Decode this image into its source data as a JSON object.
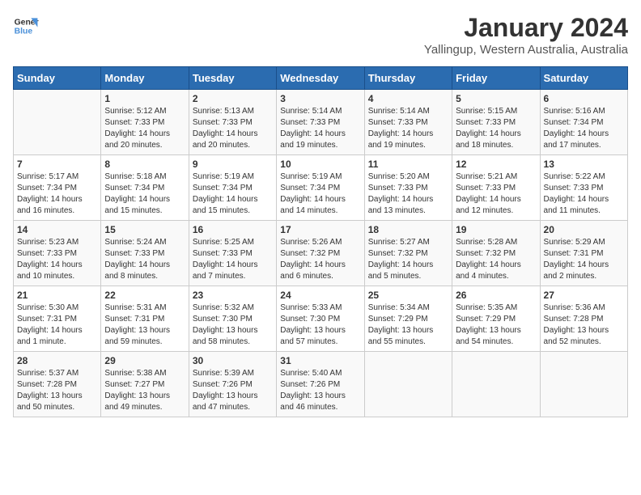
{
  "logo": {
    "line1": "General",
    "line2": "Blue"
  },
  "title": "January 2024",
  "subtitle": "Yallingup, Western Australia, Australia",
  "weekdays": [
    "Sunday",
    "Monday",
    "Tuesday",
    "Wednesday",
    "Thursday",
    "Friday",
    "Saturday"
  ],
  "weeks": [
    [
      {
        "num": "",
        "info": ""
      },
      {
        "num": "1",
        "info": "Sunrise: 5:12 AM\nSunset: 7:33 PM\nDaylight: 14 hours\nand 20 minutes."
      },
      {
        "num": "2",
        "info": "Sunrise: 5:13 AM\nSunset: 7:33 PM\nDaylight: 14 hours\nand 20 minutes."
      },
      {
        "num": "3",
        "info": "Sunrise: 5:14 AM\nSunset: 7:33 PM\nDaylight: 14 hours\nand 19 minutes."
      },
      {
        "num": "4",
        "info": "Sunrise: 5:14 AM\nSunset: 7:33 PM\nDaylight: 14 hours\nand 19 minutes."
      },
      {
        "num": "5",
        "info": "Sunrise: 5:15 AM\nSunset: 7:33 PM\nDaylight: 14 hours\nand 18 minutes."
      },
      {
        "num": "6",
        "info": "Sunrise: 5:16 AM\nSunset: 7:34 PM\nDaylight: 14 hours\nand 17 minutes."
      }
    ],
    [
      {
        "num": "7",
        "info": "Sunrise: 5:17 AM\nSunset: 7:34 PM\nDaylight: 14 hours\nand 16 minutes."
      },
      {
        "num": "8",
        "info": "Sunrise: 5:18 AM\nSunset: 7:34 PM\nDaylight: 14 hours\nand 15 minutes."
      },
      {
        "num": "9",
        "info": "Sunrise: 5:19 AM\nSunset: 7:34 PM\nDaylight: 14 hours\nand 15 minutes."
      },
      {
        "num": "10",
        "info": "Sunrise: 5:19 AM\nSunset: 7:34 PM\nDaylight: 14 hours\nand 14 minutes."
      },
      {
        "num": "11",
        "info": "Sunrise: 5:20 AM\nSunset: 7:33 PM\nDaylight: 14 hours\nand 13 minutes."
      },
      {
        "num": "12",
        "info": "Sunrise: 5:21 AM\nSunset: 7:33 PM\nDaylight: 14 hours\nand 12 minutes."
      },
      {
        "num": "13",
        "info": "Sunrise: 5:22 AM\nSunset: 7:33 PM\nDaylight: 14 hours\nand 11 minutes."
      }
    ],
    [
      {
        "num": "14",
        "info": "Sunrise: 5:23 AM\nSunset: 7:33 PM\nDaylight: 14 hours\nand 10 minutes."
      },
      {
        "num": "15",
        "info": "Sunrise: 5:24 AM\nSunset: 7:33 PM\nDaylight: 14 hours\nand 8 minutes."
      },
      {
        "num": "16",
        "info": "Sunrise: 5:25 AM\nSunset: 7:33 PM\nDaylight: 14 hours\nand 7 minutes."
      },
      {
        "num": "17",
        "info": "Sunrise: 5:26 AM\nSunset: 7:32 PM\nDaylight: 14 hours\nand 6 minutes."
      },
      {
        "num": "18",
        "info": "Sunrise: 5:27 AM\nSunset: 7:32 PM\nDaylight: 14 hours\nand 5 minutes."
      },
      {
        "num": "19",
        "info": "Sunrise: 5:28 AM\nSunset: 7:32 PM\nDaylight: 14 hours\nand 4 minutes."
      },
      {
        "num": "20",
        "info": "Sunrise: 5:29 AM\nSunset: 7:31 PM\nDaylight: 14 hours\nand 2 minutes."
      }
    ],
    [
      {
        "num": "21",
        "info": "Sunrise: 5:30 AM\nSunset: 7:31 PM\nDaylight: 14 hours\nand 1 minute."
      },
      {
        "num": "22",
        "info": "Sunrise: 5:31 AM\nSunset: 7:31 PM\nDaylight: 13 hours\nand 59 minutes."
      },
      {
        "num": "23",
        "info": "Sunrise: 5:32 AM\nSunset: 7:30 PM\nDaylight: 13 hours\nand 58 minutes."
      },
      {
        "num": "24",
        "info": "Sunrise: 5:33 AM\nSunset: 7:30 PM\nDaylight: 13 hours\nand 57 minutes."
      },
      {
        "num": "25",
        "info": "Sunrise: 5:34 AM\nSunset: 7:29 PM\nDaylight: 13 hours\nand 55 minutes."
      },
      {
        "num": "26",
        "info": "Sunrise: 5:35 AM\nSunset: 7:29 PM\nDaylight: 13 hours\nand 54 minutes."
      },
      {
        "num": "27",
        "info": "Sunrise: 5:36 AM\nSunset: 7:28 PM\nDaylight: 13 hours\nand 52 minutes."
      }
    ],
    [
      {
        "num": "28",
        "info": "Sunrise: 5:37 AM\nSunset: 7:28 PM\nDaylight: 13 hours\nand 50 minutes."
      },
      {
        "num": "29",
        "info": "Sunrise: 5:38 AM\nSunset: 7:27 PM\nDaylight: 13 hours\nand 49 minutes."
      },
      {
        "num": "30",
        "info": "Sunrise: 5:39 AM\nSunset: 7:26 PM\nDaylight: 13 hours\nand 47 minutes."
      },
      {
        "num": "31",
        "info": "Sunrise: 5:40 AM\nSunset: 7:26 PM\nDaylight: 13 hours\nand 46 minutes."
      },
      {
        "num": "",
        "info": ""
      },
      {
        "num": "",
        "info": ""
      },
      {
        "num": "",
        "info": ""
      }
    ]
  ]
}
